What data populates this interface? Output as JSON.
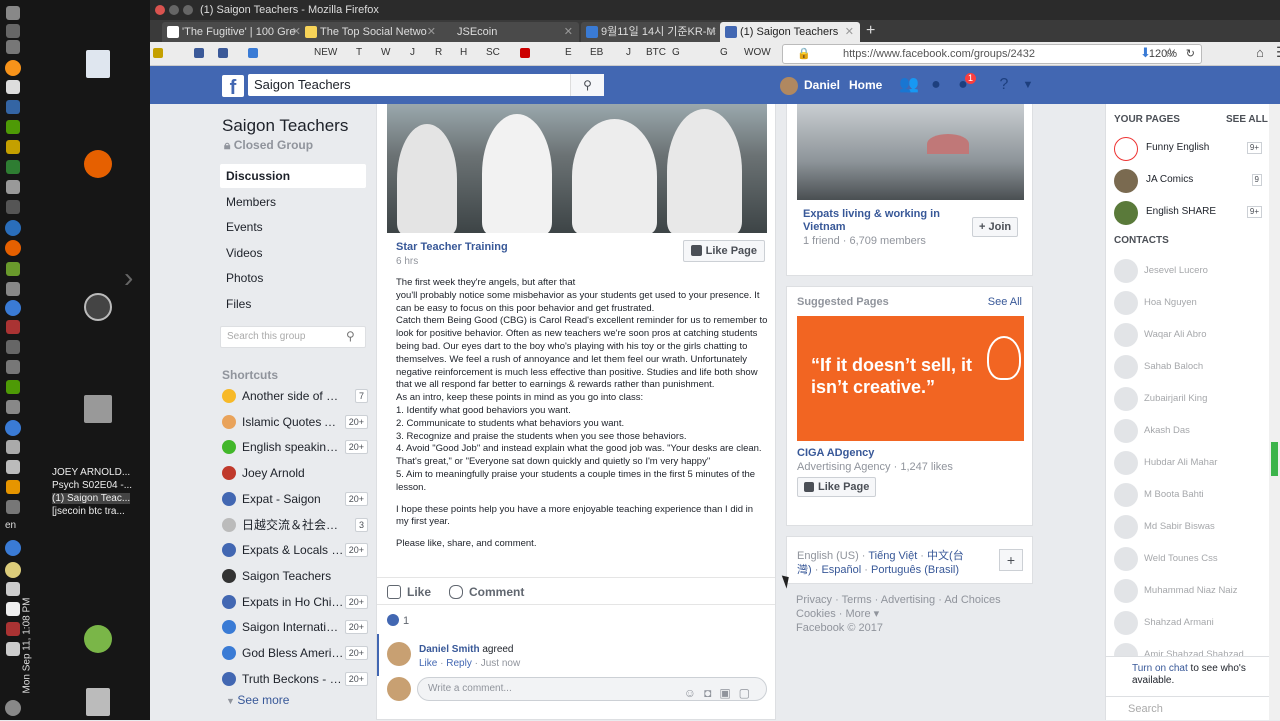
{
  "window": {
    "title": "(1) Saigon Teachers - Mozilla Firefox"
  },
  "tabs": [
    {
      "label": "'The Fugitive' | 100 Gre"
    },
    {
      "label": "The Top Social Netwo"
    },
    {
      "label": "JSEcoin"
    },
    {
      "label": "9월11일 14시 기준KR-M"
    },
    {
      "label": "(1) Saigon Teachers"
    }
  ],
  "bookmarks": [
    "NEW",
    "T",
    "W",
    "J",
    "R",
    "H",
    "SC",
    "E",
    "EB",
    "J",
    "BTC",
    "G",
    "G",
    "WOW"
  ],
  "url": {
    "value": "https://www.facebook.com/groups/2432",
    "zoom": "120%"
  },
  "dock": {
    "clock": "Mon Sep 11, 1:08 PM",
    "lang": "en",
    "windows": [
      "JOEY ARNOLD...",
      "Psych S02E04 -...",
      "(1) Saigon Teac...",
      "[jsecoin btc tra..."
    ]
  },
  "header": {
    "search_value": "Saigon Teachers",
    "user": "Daniel",
    "home": "Home",
    "notif_count": "1"
  },
  "group": {
    "title": "Saigon Teachers",
    "privacy": "Closed Group",
    "search_placeholder": "Search this group"
  },
  "nav": [
    {
      "label": "Discussion"
    },
    {
      "label": "Members"
    },
    {
      "label": "Events"
    },
    {
      "label": "Videos"
    },
    {
      "label": "Photos"
    },
    {
      "label": "Files"
    }
  ],
  "shortcuts": {
    "heading": "Shortcuts",
    "see_more": "See more",
    "items": [
      {
        "label": "Another side of Vietn...",
        "count": "7",
        "color": "#f7b928"
      },
      {
        "label": "Islamic Quotes And...",
        "count": "20+",
        "color": "#e9a35b"
      },
      {
        "label": "English speaking g...",
        "count": "20+",
        "color": "#42b72a"
      },
      {
        "label": "Joey Arnold",
        "count": "",
        "color": "#c0392b"
      },
      {
        "label": "Expat - Saigon",
        "count": "20+",
        "color": "#4267b2"
      },
      {
        "label": "日越交流＆社会人ボ...",
        "count": "3",
        "color": "#bbbbbb"
      },
      {
        "label": "Expats & Locals In ...",
        "count": "20+",
        "color": "#4267b2"
      },
      {
        "label": "Saigon Teachers",
        "count": "",
        "color": "#333333"
      },
      {
        "label": "Expats in Ho Chi Mi...",
        "count": "20+",
        "color": "#4267b2"
      },
      {
        "label": "Saigon Internation...",
        "count": "20+",
        "color": "#3a7bd5"
      },
      {
        "label": "God Bless America...",
        "count": "20+",
        "color": "#3a7bd5"
      },
      {
        "label": "Truth Beckons - No...",
        "count": "20+",
        "color": "#4267b2"
      }
    ]
  },
  "post": {
    "page_name": "Star Teacher Training",
    "time": "6 hrs",
    "like_page": "Like Page",
    "body": [
      "The first week they're angels, but after that",
      "you'll probably notice some misbehavior as your students get used to your presence. It can be easy to focus on this poor behavior and get frustrated.",
      "Catch them Being Good (CBG) is Carol Read's excellent reminder for us to remember to look for positive behavior. Often as new teachers we're soon pros at catching students being bad. Our eyes dart to the boy who's playing with his toy or the girls chatting to themselves. We feel a rush of annoyance and let them feel our wrath. Unfortunately negative reinforcement is much less effective than positive. Studies and life both show that we all respond far better to earnings & rewards rather than punishment.",
      "As an intro, keep these points in mind as you go into class:",
      "1. Identify what good behaviors you want.",
      "2. Communicate to students what behaviors you want.",
      "3. Recognize and praise the students when you see those behaviors.",
      "4. Avoid \"Good Job\" and instead explain what the good job was. \"Your desks are clean. That's great,\" or \"Everyone sat down quickly and quietly so I'm very happy\"",
      "5. Aim to meaningfully praise your students a couple times in the first 5 minutes of the lesson."
    ],
    "closing": "I hope these points help you have a more enjoyable teaching experience than I did in my first year.",
    "signoff": "Please like, share, and comment.",
    "like": "Like",
    "comment": "Comment",
    "like_count": "1",
    "comment_author": "Daniel Smith",
    "comment_text": "agreed",
    "comment_like": "Like",
    "comment_reply": "Reply",
    "comment_time": "Just now",
    "write_placeholder": "Write a comment..."
  },
  "suggested_group": {
    "name": "Expats living & working in Vietnam",
    "meta": "1 friend · 6,709 members",
    "join": "Join"
  },
  "suggested_pages": {
    "heading": "Suggested Pages",
    "see_all": "See All",
    "ad_text": "“If it doesn’t sell, it isn’t creative.”",
    "name": "CIGA ADgency",
    "meta": "Advertising Agency · 1,247 likes",
    "like": "Like Page"
  },
  "languages": {
    "current": "English (US) · ",
    "links": [
      "Tiếng Việt",
      "中文(台灣)",
      "Español",
      "Português (Brasil)"
    ]
  },
  "footer": {
    "links": "Privacy · Terms · Advertising · Ad Choices",
    "more": "Cookies · More ▾",
    "copyright": "Facebook © 2017"
  },
  "chat": {
    "pages_heading": "YOUR PAGES",
    "see_all": "SEE ALL",
    "pages": [
      {
        "name": "Funny English",
        "count": "9+"
      },
      {
        "name": "JA Comics",
        "count": "9"
      },
      {
        "name": "English SHARE",
        "count": "9+"
      }
    ],
    "contacts_heading": "CONTACTS",
    "contacts": [
      "Jesevel Lucero",
      "Hoa Nguyen",
      "Waqar Ali Abro",
      "Sahab Baloch",
      "Zubairjaril King",
      "Akash Das",
      "Hubdar Ali Mahar",
      "M Boota Bahti",
      "Md Sabir Biswas",
      "Weld Tounes Css",
      "Muhammad Niaz Naiz",
      "Shahzad Armani",
      "Amir Shahzad Shahzad"
    ],
    "turn_on": "Turn on chat",
    "turn_on_rest": " to see who's available.",
    "search": "Search"
  }
}
